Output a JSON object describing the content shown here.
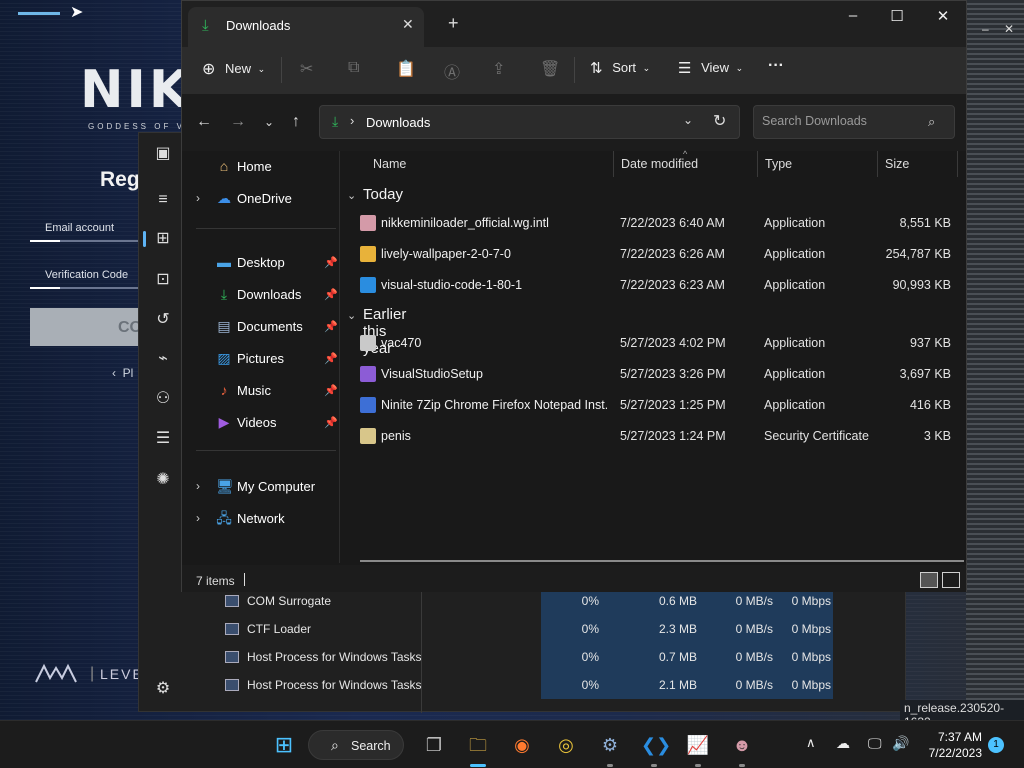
{
  "background": {
    "logo": "NIKK",
    "logo_sub": "GODDESS OF VI",
    "register_title": "Regis",
    "email_label": "Email account",
    "verification_label": "Verification Code",
    "button_label": "CO",
    "prev_label": "Pl",
    "brand_right": "LEVE"
  },
  "task_manager": {
    "rows": [
      {
        "name": "COM Surrogate",
        "cpu": "0%",
        "memory": "0.6 MB",
        "disk": "0 MB/s",
        "network": "0 Mbps"
      },
      {
        "name": "CTF Loader",
        "cpu": "0%",
        "memory": "2.3 MB",
        "disk": "0 MB/s",
        "network": "0 Mbps"
      },
      {
        "name": "Host Process for Windows Tasks",
        "cpu": "0%",
        "memory": "0.7 MB",
        "disk": "0 MB/s",
        "network": "0 Mbps"
      },
      {
        "name": "Host Process for Windows Tasks",
        "cpu": "0%",
        "memory": "2.1 MB",
        "disk": "0 MB/s",
        "network": "0 Mbps"
      }
    ],
    "build_text": "n_release.230520-1632"
  },
  "explorer": {
    "tab_title": "Downloads",
    "toolbar": {
      "new_label": "New",
      "sort_label": "Sort",
      "view_label": "View",
      "more_label": "···"
    },
    "address": {
      "crumb": "Downloads"
    },
    "search": {
      "placeholder": "Search Downloads"
    },
    "nav": {
      "home": "Home",
      "onedrive": "OneDrive",
      "desktop": "Desktop",
      "downloads": "Downloads",
      "documents": "Documents",
      "pictures": "Pictures",
      "music": "Music",
      "videos": "Videos",
      "my_computer": "My Computer",
      "network": "Network"
    },
    "columns": {
      "name": "Name",
      "date": "Date modified",
      "type": "Type",
      "size": "Size"
    },
    "groups": {
      "today": "Today",
      "earlier": "Earlier this year"
    },
    "files_today": [
      {
        "name": "nikkeminiloader_official.wg.intl",
        "date": "7/22/2023 6:40 AM",
        "type": "Application",
        "size": "8,551 KB",
        "icon": "nikke-app-icon",
        "color": "#d49aa8"
      },
      {
        "name": "lively-wallpaper-2-0-7-0",
        "date": "7/22/2023 6:26 AM",
        "type": "Application",
        "size": "254,787 KB",
        "icon": "lively-app-icon",
        "color": "#e8b23a"
      },
      {
        "name": "visual-studio-code-1-80-1",
        "date": "7/22/2023 6:23 AM",
        "type": "Application",
        "size": "90,993 KB",
        "icon": "vscode-icon",
        "color": "#2a8de0"
      }
    ],
    "files_earlier": [
      {
        "name": "vac470",
        "date": "5/27/2023 4:02 PM",
        "type": "Application",
        "size": "937 KB",
        "icon": "vac-app-icon",
        "color": "#c9c9c9"
      },
      {
        "name": "VisualStudioSetup",
        "date": "5/27/2023 3:26 PM",
        "type": "Application",
        "size": "3,697 KB",
        "icon": "visual-studio-icon",
        "color": "#8c5cd6"
      },
      {
        "name": "Ninite 7Zip Chrome Firefox Notepad Inst...",
        "date": "5/27/2023 1:25 PM",
        "type": "Application",
        "size": "416 KB",
        "icon": "ninite-icon",
        "color": "#3d6fd6"
      },
      {
        "name": "penis",
        "date": "5/27/2023 1:24 PM",
        "type": "Security Certificate",
        "size": "3 KB",
        "icon": "certificate-icon",
        "color": "#d8c68a"
      }
    ],
    "status": {
      "item_count": "7 items"
    }
  },
  "taskbar": {
    "search_label": "Search",
    "time": "7:37 AM",
    "date": "7/22/2023",
    "notification_count": "1"
  }
}
